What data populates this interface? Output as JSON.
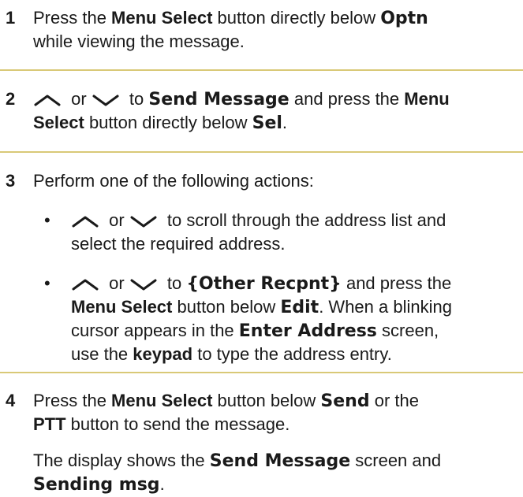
{
  "step1": {
    "number": "1",
    "t1": "Press the ",
    "menu_select": "Menu Select",
    "t2": " button directly below ",
    "optn": "Optn",
    "t3": "while viewing the message."
  },
  "step2": {
    "number": "2",
    "or": " or ",
    "to": " to ",
    "send_message": "Send Message",
    "t1": " and press the ",
    "menu": "Menu",
    "select": "Select",
    "t2": " button directly below ",
    "sel": "Sel",
    "period": "."
  },
  "step3": {
    "number": "3",
    "intro": "Perform one of the following actions:",
    "bullet_char": "•",
    "b1_or": " or ",
    "b1_t1": " to scroll through the address list and",
    "b1_t2": "select the required address.",
    "b2_or": " or ",
    "b2_to": " to ",
    "other_recpnt": "{Other Recpnt}",
    "b2_t1": " and press the",
    "menu_select": "Menu Select",
    "b2_t2": " button below ",
    "edit": "Edit",
    "b2_t3": ". When a blinking",
    "b2_t4": "cursor appears in the ",
    "enter_address": "Enter Address",
    "b2_t5": " screen,",
    "b2_t6": "use the ",
    "keypad": "keypad",
    "b2_t7": " to type the address entry."
  },
  "step4": {
    "number": "4",
    "t1": "Press the ",
    "menu_select": "Menu Select",
    "t2": " button below ",
    "send": "Send",
    "t3": " or the",
    "ptt": "PTT",
    "t4": " button to send the message.",
    "t5": "The display shows the ",
    "send_message": "Send Message",
    "t6": " screen and",
    "sending_msg": "Sending msg",
    "period": "."
  },
  "colors": {
    "separator": "#d9c977",
    "text": "#1a1a1a"
  },
  "icons": {
    "up": "nav-up-arrow-icon",
    "down": "nav-down-arrow-icon"
  }
}
